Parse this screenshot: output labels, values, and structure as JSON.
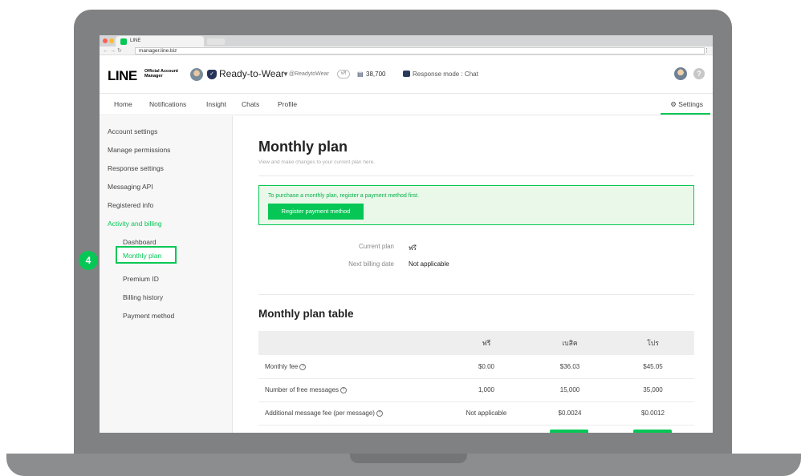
{
  "colors": {
    "accent": "#06c755",
    "frame": "#808182",
    "sidebar_bg": "#f7f7f7"
  },
  "browser": {
    "tab_title": "LINE",
    "url": "manager.line.biz"
  },
  "header": {
    "brand": "LINE",
    "brand_sub": "Official Account Manager",
    "account_name": "Ready-to-Wear",
    "account_id": "@ReadytoWear",
    "account_pill": "ฟรี",
    "friends_count": "38,700",
    "response_mode": "Response mode : Chat",
    "help_icon_text": "?"
  },
  "nav": {
    "items": [
      "Home",
      "Notifications",
      "Insight",
      "Chats",
      "Profile"
    ],
    "settings": "Settings"
  },
  "sidebar": {
    "items": [
      "Account settings",
      "Manage permissions",
      "Response settings",
      "Messaging API",
      "Registered info",
      "Activity and billing"
    ],
    "subitems": [
      "Dashboard",
      "Monthly plan",
      "Premium ID",
      "Billing history",
      "Payment method"
    ]
  },
  "main": {
    "title": "Monthly plan",
    "description": "View and make changes to your current plan here.",
    "alert_text": "To purchase a monthly plan, register a payment method first.",
    "alert_button": "Register payment method",
    "current_plan_label": "Current plan",
    "current_plan_value": "ฟรี",
    "next_billing_label": "Next billing date",
    "next_billing_value": "Not applicable",
    "table_title": "Monthly plan table",
    "table": {
      "headers": [
        "",
        "ฟรี",
        "เบสิค",
        "โปร"
      ],
      "rows": [
        {
          "label": "Monthly fee",
          "values": [
            "$0.00",
            "$36.03",
            "$45.05"
          ]
        },
        {
          "label": "Number of free messages",
          "values": [
            "1,000",
            "15,000",
            "35,000"
          ]
        },
        {
          "label": "Additional message fee (per message)",
          "values": [
            "Not applicable",
            "$0.0024",
            "$0.0012"
          ]
        }
      ]
    }
  },
  "step_badge": "4"
}
